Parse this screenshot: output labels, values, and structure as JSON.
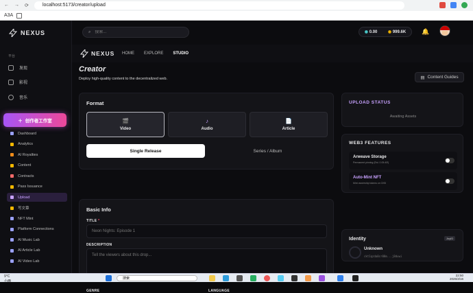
{
  "browser": {
    "url": "localhost:5173/creator/upload",
    "bookmark": "A3A"
  },
  "sidebar": {
    "brand": "NEXUS",
    "section_label": "平台",
    "nav": [
      {
        "label": "发现"
      },
      {
        "label": "影视"
      },
      {
        "label": "音乐"
      }
    ],
    "studio_button": "创作者工作室",
    "menu": [
      {
        "label": "Dashboard",
        "color": "#9aa0ff"
      },
      {
        "label": "Analytics",
        "color": "#f5b800"
      },
      {
        "label": "AI Royalties",
        "color": "#f08c1a"
      },
      {
        "label": "Content",
        "color": "#f5b800"
      },
      {
        "label": "Contracts",
        "color": "#ff6b6b"
      },
      {
        "label": "Pass Issuance",
        "color": "#f5b800"
      },
      {
        "label": "Upload",
        "color": "#c8a2ff",
        "active": true
      },
      {
        "label": "写文章",
        "color": "#f5b800"
      },
      {
        "label": "NFT Mint",
        "color": "#9aa0ff"
      },
      {
        "label": "Platform Connections",
        "color": "#9aa0ff"
      },
      {
        "label": "AI Music Lab",
        "color": "#9aa0ff"
      },
      {
        "label": "AI Article Lab",
        "color": "#9aa0ff"
      },
      {
        "label": "AI Video Lab",
        "color": "#9aa0ff"
      }
    ]
  },
  "topbar": {
    "search_placeholder": "搜索...",
    "balance_1": "0.00",
    "balance_2": "999.6K"
  },
  "studio_header": {
    "brand": "NEXUS",
    "tabs": [
      {
        "label": "HOME"
      },
      {
        "label": "EXPLORE"
      },
      {
        "label": "STUDIO"
      }
    ]
  },
  "page": {
    "title": "Creator",
    "subtitle": "Deploy high-quality content to the decentralized web.",
    "guides_button": "Content Guides"
  },
  "format": {
    "title": "Format",
    "options": [
      {
        "label": "Video",
        "icon": "film-icon",
        "glyph": "🎬",
        "selected": true
      },
      {
        "label": "Audio",
        "icon": "music-icon",
        "glyph": "♪"
      },
      {
        "label": "Article",
        "icon": "document-icon",
        "glyph": "📄"
      }
    ],
    "release": [
      {
        "label": "Single Release",
        "selected": true
      },
      {
        "label": "Series / Album"
      }
    ]
  },
  "basic_info": {
    "title": "Basic Info",
    "title_label": "TITLE",
    "title_placeholder": "Neon Nights: Episode 1",
    "description_label": "DESCRIPTION",
    "description_placeholder": "Tell the viewers about this drop...",
    "genre_label": "GENRE",
    "language_label": "LANGUAGE"
  },
  "upload_status": {
    "title": "UPLOAD STATUS",
    "status": "Awaiting Assets"
  },
  "web3": {
    "title": "WEB3 FEATURES",
    "features": [
      {
        "name": "Arweave Storage",
        "desc": "Permanent pinning (Est. 0.05 AR)",
        "color": "#ffffff"
      },
      {
        "name": "Auto-Mint NFT",
        "desc": "Mint ownership tokens on CKB",
        "color": "#c8a2ff"
      }
    ]
  },
  "identity": {
    "title": "Identity",
    "badge": "JoyID",
    "name": "Unknown",
    "address": "ckt1qzda0cr08m...j8duwi"
  },
  "taskbar": {
    "weather": "9°C",
    "weather_desc": "小雨",
    "search": "搜索",
    "time": "22:50",
    "date": "2026/3/16"
  },
  "colors": {
    "accent": "#a855f7",
    "accent2": "#ec4899"
  }
}
